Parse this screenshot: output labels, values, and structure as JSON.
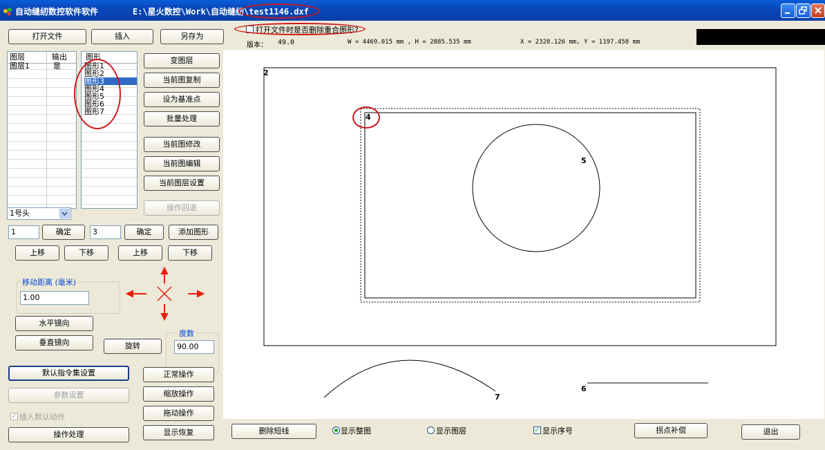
{
  "titlebar": {
    "app_title": "自动缝纫数控软件软件",
    "file_path": "E:\\星火数控\\Work\\自动缝纫\\test1146.dxf"
  },
  "toolbar": {
    "open": "打开文件",
    "insert": "插入",
    "save_as": "另存为",
    "delete_overlap_label": "打开文件时是否删除重合图形?",
    "delete_overlap_checked": false,
    "version_label": "版本：",
    "version_value": "49.0",
    "size_readout": "W = 4469.015 mm , H = 2885.535 mm",
    "coord_readout": "X = 2328.126 mm, Y = 1197.458 mm"
  },
  "layer_list": {
    "col_layer": "图层",
    "col_output": "输出",
    "rows": [
      {
        "layer": "图层1",
        "output": "是"
      }
    ]
  },
  "shape_list": {
    "header": "图形",
    "items": [
      "图形1",
      "图形2",
      "图形3",
      "图形4",
      "图形5",
      "图形6",
      "图形7"
    ],
    "selected": "图形3"
  },
  "actions": {
    "change_layer": "变图层",
    "copy_current": "当前图复制",
    "set_base": "设为基准点",
    "batch": "批量处理",
    "modify_current": "当前图修改",
    "edit_current": "当前图编辑",
    "layer_settings": "当前图层设置",
    "undo": "操作回退"
  },
  "head_select": "1号头",
  "row1": {
    "input1": "1",
    "ok1": "确定",
    "input2": "3",
    "ok2": "确定",
    "add_shape": "添加图形"
  },
  "moves": {
    "up1": "上移",
    "down1": "下移",
    "up2": "上移",
    "down2": "下移"
  },
  "move_distance": {
    "label": "移动距离 (毫米)",
    "value": "1.00"
  },
  "mirror": {
    "horizontal": "水平镜向",
    "vertical": "垂直镜向",
    "rotate": "旋转"
  },
  "degrees": {
    "label": "度数",
    "value": "90.00"
  },
  "bottom_left": {
    "default_cmd": "默认指令集设置",
    "params": "参数设置",
    "insert_default_label": "插入默认动作",
    "insert_default_checked": true,
    "process": "操作处理"
  },
  "mode_buttons": {
    "normal": "正常操作",
    "zoom": "缩放操作",
    "drag": "拖动操作",
    "restore": "显示恢复"
  },
  "bottom_bar": {
    "delete_short": "删除短线",
    "show_full": "显示整图",
    "show_layer": "显示图层",
    "show_order": "显示序号",
    "knot_comp": "拐点补偿",
    "exit": "退出",
    "show_full_selected": true,
    "show_layer_selected": false,
    "show_order_checked": true
  },
  "canvas_labels": {
    "n2": "2",
    "n4": "4",
    "n5": "5",
    "n6": "6",
    "n7": "7"
  },
  "colors": {
    "accent_annotation": "#d0181b",
    "selection": "#316ac5",
    "arrow": "#e8200e"
  }
}
